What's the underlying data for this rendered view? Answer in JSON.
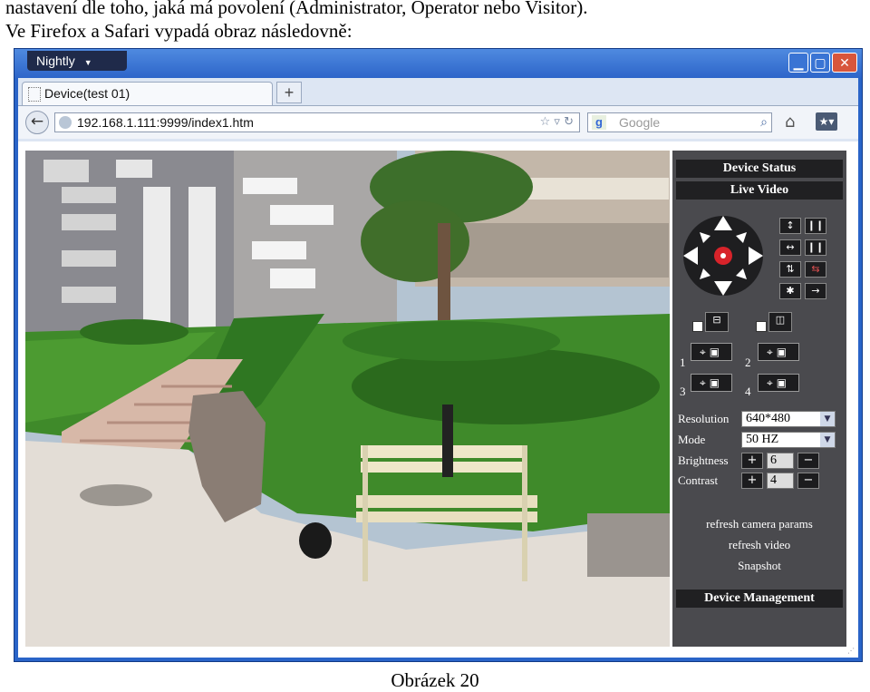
{
  "document": {
    "line1": "nastavení dle toho, jaká má povolení (Administrator, Operator nebo Visitor).",
    "line2": "Ve Firefox a Safari vypadá obraz následovně:",
    "caption": "Obrázek 20"
  },
  "browser": {
    "app_menu": "Nightly",
    "tab_title": "Device(test 01)",
    "new_tab": "+",
    "back": "←",
    "url": "192.168.1.111:9999/index1.htm",
    "search_engine_glyph": "g",
    "search_placeholder": "Google",
    "search_icon": "search-icon",
    "home_icon": "home-icon",
    "bookmarks_icon": "bookmarks-icon",
    "window_controls": [
      "minimize-icon",
      "maximize-icon",
      "close-icon"
    ]
  },
  "panel": {
    "device_status": "Device Status",
    "live_video": "Live Video",
    "presets": [
      "1",
      "2",
      "3",
      "4"
    ],
    "resolution_label": "Resolution",
    "resolution_value": "640*480",
    "mode_label": "Mode",
    "mode_value": "50 HZ",
    "brightness_label": "Brightness",
    "brightness_value": "6",
    "contrast_label": "Contrast",
    "contrast_value": "4",
    "plus": "+",
    "minus": "−",
    "refresh_params": "refresh camera params",
    "refresh_video": "refresh video",
    "snapshot": "Snapshot",
    "device_management": "Device Management"
  },
  "colors": {
    "window_blue": "#2a64c8",
    "panel_bg": "#4a4a4e",
    "panel_header": "#202022",
    "ptz_center": "#d8232a"
  }
}
